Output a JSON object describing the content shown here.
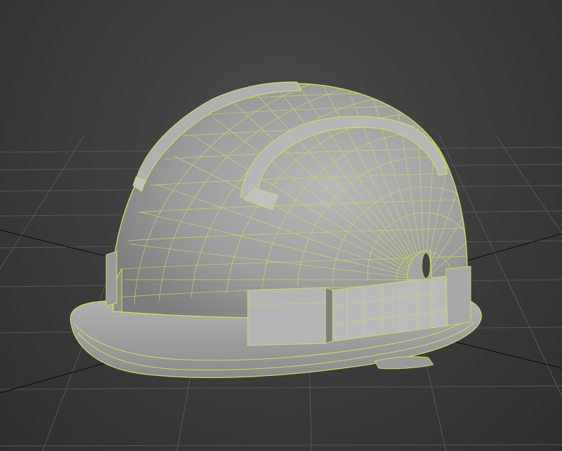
{
  "viewport": {
    "kind": "3d-perspective-viewport",
    "shading": "smooth-shaded-with-edged-faces",
    "grid": true
  },
  "scene_object": {
    "name": "safety-helmet",
    "wireframe_color": "#c8e05a",
    "surface_color": "#a0a0a0"
  },
  "colors": {
    "background": "#3b3b3b",
    "grid_line": "#555555",
    "world_axis": "#000000"
  }
}
